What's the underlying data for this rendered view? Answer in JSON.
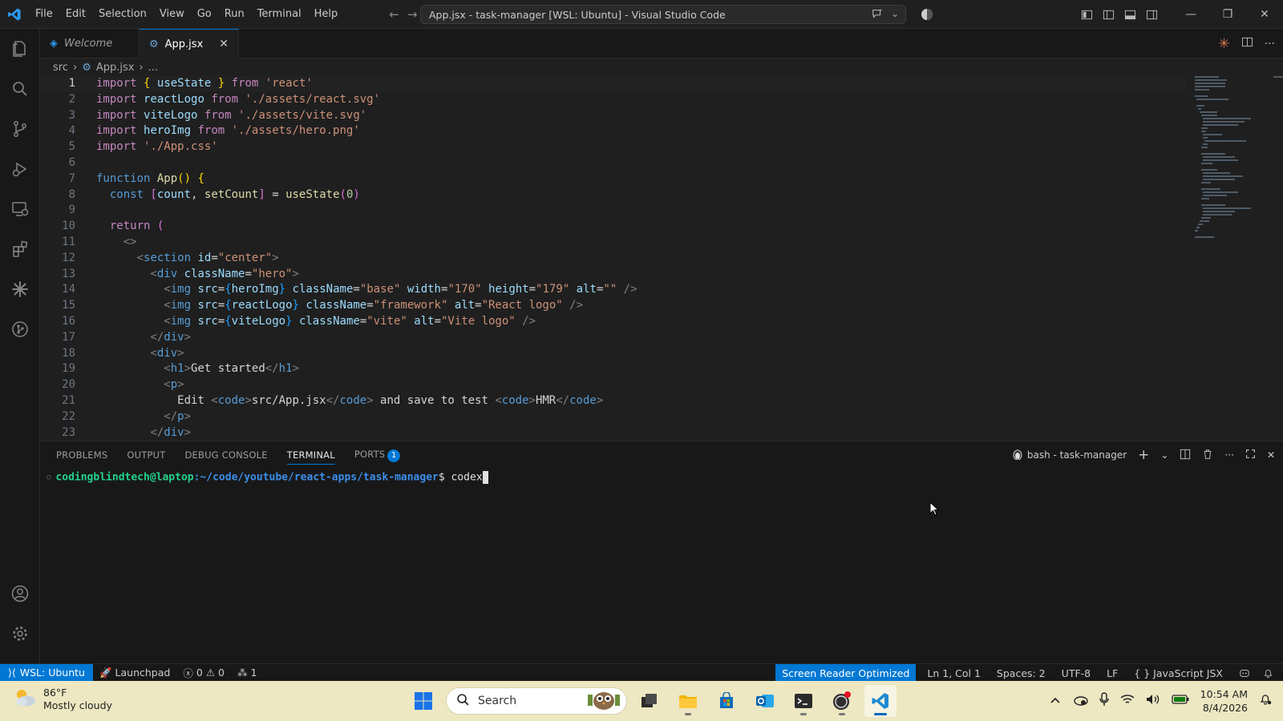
{
  "titlebar": {
    "menu": [
      "File",
      "Edit",
      "Selection",
      "View",
      "Go",
      "Run",
      "Terminal",
      "Help"
    ],
    "command_center": "App.jsx - task-manager [WSL: Ubuntu] - Visual Studio Code"
  },
  "tabs": [
    {
      "label": "Welcome",
      "icon": "vscode-icon"
    },
    {
      "label": "App.jsx",
      "icon": "gear-icon"
    }
  ],
  "breadcrumb": {
    "folder": "src",
    "file": "App.jsx",
    "more": "..."
  },
  "editor": {
    "line_numbers": [
      "1",
      "2",
      "3",
      "4",
      "5",
      "6",
      "7",
      "8",
      "9",
      "10",
      "11",
      "12",
      "13",
      "14",
      "15",
      "16",
      "17",
      "18",
      "19",
      "20",
      "21",
      "22",
      "23"
    ],
    "lines": [
      "import { useState } from 'react'",
      "import reactLogo from './assets/react.svg'",
      "import viteLogo from './assets/vite.svg'",
      "import heroImg from './assets/hero.png'",
      "import './App.css'",
      "",
      "function App() {",
      "  const [count, setCount] = useState(0)",
      "",
      "  return (",
      "    <>",
      "      <section id=\"center\">",
      "        <div className=\"hero\">",
      "          <img src={heroImg} className=\"base\" width=\"170\" height=\"179\" alt=\"\" />",
      "          <img src={reactLogo} className=\"framework\" alt=\"React logo\" />",
      "          <img src={viteLogo} className=\"vite\" alt=\"Vite logo\" />",
      "        </div>",
      "        <div>",
      "          <h1>Get started</h1>",
      "          <p>",
      "            Edit <code>src/App.jsx</code> and save to test <code>HMR</code>",
      "          </p>",
      "        </div>"
    ]
  },
  "panel": {
    "tabs": [
      "PROBLEMS",
      "OUTPUT",
      "DEBUG CONSOLE",
      "TERMINAL",
      "PORTS"
    ],
    "active_tab": "TERMINAL",
    "ports_count": "1",
    "terminal_name": "bash - task-manager",
    "prompt_user": "codingblindtech@laptop",
    "prompt_path": ":~/code/youtube/react-apps/task-manager",
    "prompt_symbol": "$",
    "command": "codex"
  },
  "statusbar": {
    "remote": "WSL: Ubuntu",
    "launchpad": "Launchpad",
    "errors": "0",
    "warnings": "0",
    "ports": "1",
    "screen_reader": "Screen Reader Optimized",
    "position": "Ln 1, Col 1",
    "spaces": "Spaces: 2",
    "encoding": "UTF-8",
    "eol": "LF",
    "language": "JavaScript JSX"
  },
  "taskbar": {
    "weather_temp": "86°F",
    "weather_desc": "Mostly cloudy",
    "search_placeholder": "Search",
    "time": "10:54 AM",
    "date": "8/4/2026"
  },
  "colors": {
    "accent": "#0078d4",
    "terminal_user": "#23d18b",
    "terminal_path": "#3b8eea",
    "keyword": "#c586c0",
    "string": "#ce9178"
  }
}
